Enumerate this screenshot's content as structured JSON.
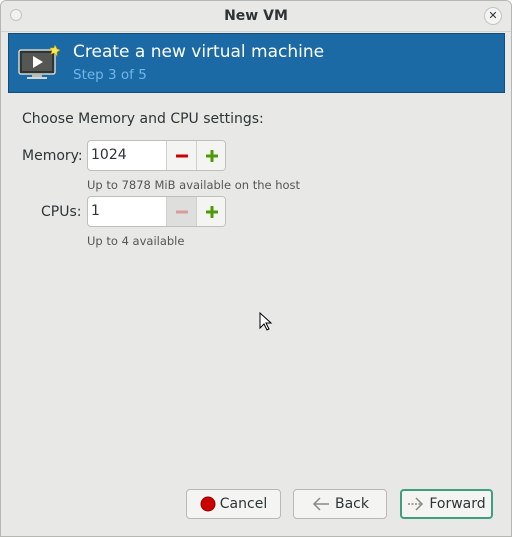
{
  "window": {
    "title": "New VM"
  },
  "header": {
    "title": "Create a new virtual machine",
    "step": "Step 3 of 5"
  },
  "prompt": "Choose Memory and CPU settings:",
  "memory": {
    "label": "Memory:",
    "value": "1024",
    "hint": "Up to 7878 MiB available on the host"
  },
  "cpus": {
    "label": "CPUs:",
    "value": "1",
    "hint": "Up to 4 available"
  },
  "buttons": {
    "cancel": "Cancel",
    "back": "Back",
    "forward": "Forward"
  },
  "colors": {
    "header_bg": "#1b6aa5",
    "step_text": "#72b6e8",
    "minus": "#cc0000",
    "plus": "#4e9a06",
    "forward_border": "#3f9e80"
  },
  "icons": {
    "header": "vm-monitor-icon",
    "decrement": "minus-icon",
    "increment": "plus-icon",
    "cancel": "stop-icon",
    "back": "back-arrow-icon",
    "forward": "forward-arrow-icon",
    "close": "close-icon"
  }
}
